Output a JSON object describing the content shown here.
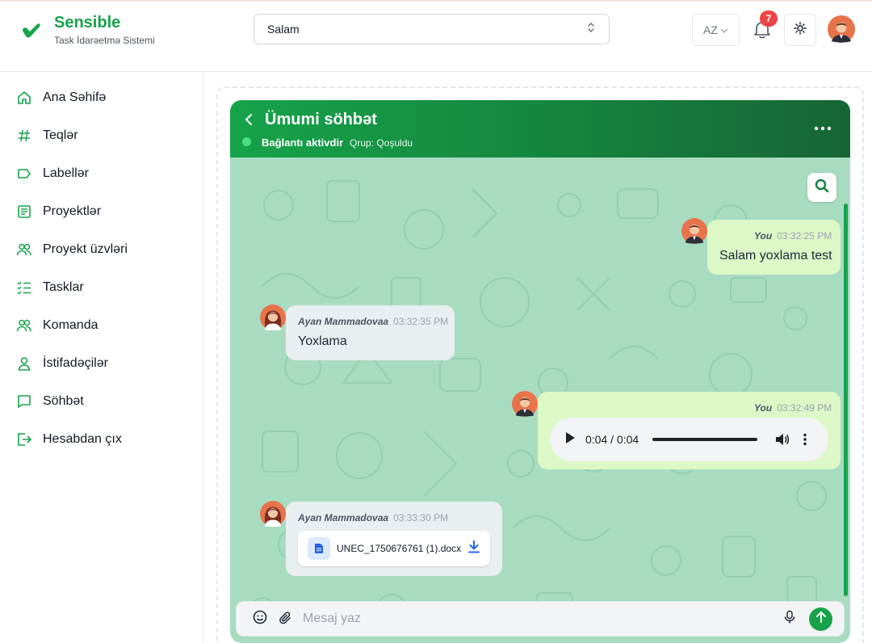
{
  "app": {
    "brand_name": "Sensible",
    "brand_subtitle": "Task İdarəetmə Sistemi",
    "accent_color": "#16a34a"
  },
  "header": {
    "project_select": {
      "value": "Salam"
    },
    "language": "AZ",
    "notifications_count": "7",
    "icons": [
      "bell-icon",
      "sun-icon",
      "chevron-up-down-icon",
      "chevron-down-icon"
    ]
  },
  "sidebar": {
    "items": [
      {
        "label": "Ana Səhifə",
        "icon": "home-icon"
      },
      {
        "label": "Teqlər",
        "icon": "hash-icon"
      },
      {
        "label": "Labellər",
        "icon": "label-icon"
      },
      {
        "label": "Proyektlər",
        "icon": "document-icon"
      },
      {
        "label": "Proyekt üzvləri",
        "icon": "users-icon"
      },
      {
        "label": "Tasklar",
        "icon": "checklist-icon"
      },
      {
        "label": "Komanda",
        "icon": "team-icon"
      },
      {
        "label": "İstifadəçilər",
        "icon": "user-icon"
      },
      {
        "label": "Söhbət",
        "icon": "chat-icon"
      },
      {
        "label": "Hesabdan çıx",
        "icon": "logout-icon"
      }
    ]
  },
  "chat": {
    "title": "Ümumi söhbət",
    "status": "Bağlantı aktivdir",
    "group_status": "Qrup: Qoşuldu",
    "status_color": "#4ade80",
    "messages": [
      {
        "sender": "You",
        "time": "03:32:25 PM",
        "text": "Salam yoxlama test",
        "type": "text"
      },
      {
        "sender": "Ayan Mammadovaa",
        "time": "03:32:35 PM",
        "text": "Yoxlama",
        "type": "text"
      },
      {
        "sender": "You",
        "time": "03:32:49 PM",
        "type": "audio",
        "audio_time": "0:04 / 0:04",
        "progress_fraction": 1.0
      },
      {
        "sender": "Ayan Mammadovaa",
        "time": "03:33:30 PM",
        "type": "file",
        "file_name": "UNEC_1750676761 (1).docx"
      }
    ],
    "composer": {
      "placeholder": "Mesaj yaz"
    }
  }
}
